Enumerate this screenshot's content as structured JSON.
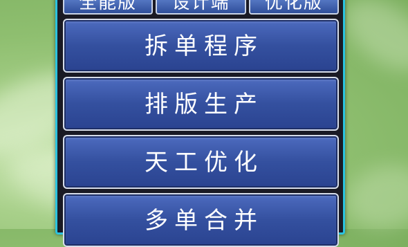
{
  "tabs": [
    {
      "label": "全能版"
    },
    {
      "label": "设计端"
    },
    {
      "label": "优化版"
    }
  ],
  "menu": {
    "items": [
      {
        "label": "拆单程序"
      },
      {
        "label": "排版生产"
      },
      {
        "label": "天工优化"
      },
      {
        "label": "多单合并"
      }
    ]
  },
  "colors": {
    "background": "#8fbf70",
    "panel_border": "#2bc4e0",
    "button_fill": "#34509f",
    "button_border": "#d7dde9",
    "text": "#ffffff"
  }
}
